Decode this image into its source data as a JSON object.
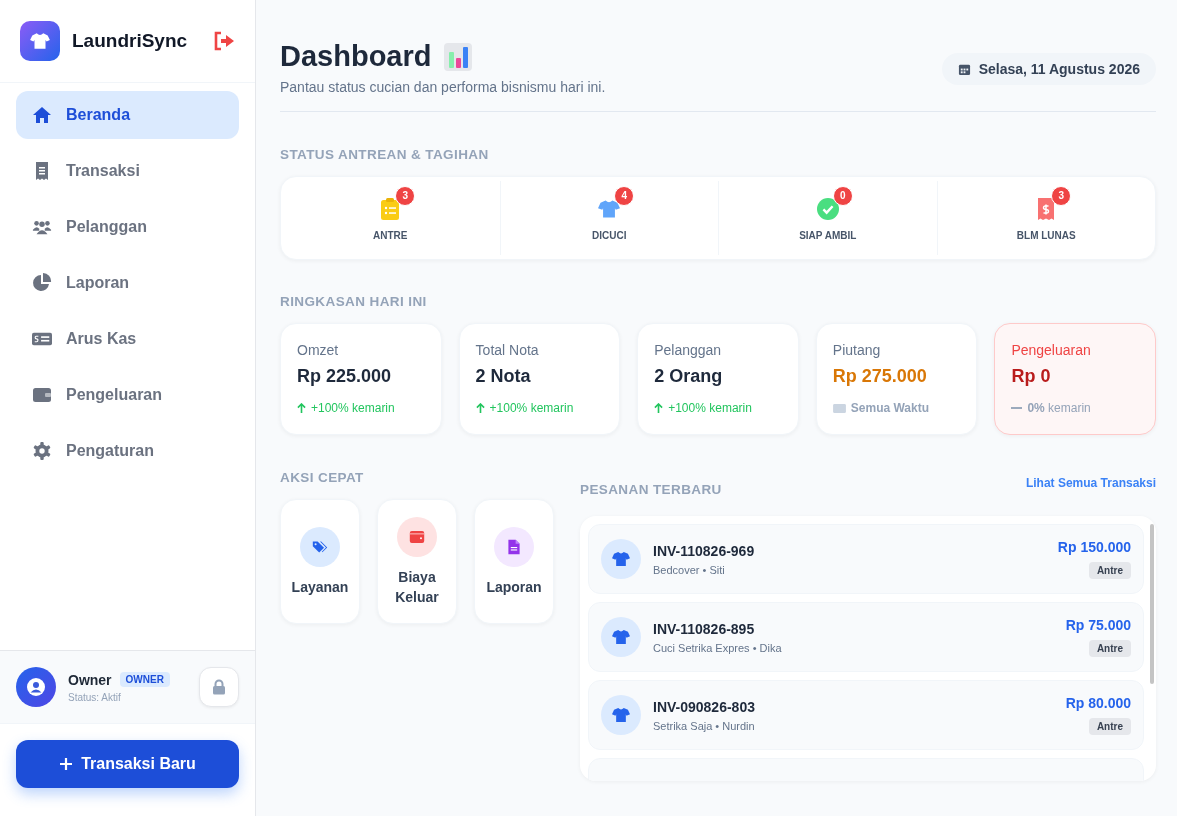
{
  "sidebar": {
    "brand": "LaundriSync",
    "items": [
      {
        "label": "Beranda",
        "kind": "home",
        "selected": true
      },
      {
        "label": "Transaksi",
        "kind": "receipt",
        "selected": false
      },
      {
        "label": "Pelanggan",
        "kind": "users",
        "selected": false
      },
      {
        "label": "Laporan",
        "kind": "pie",
        "selected": false
      },
      {
        "label": "Arus Kas",
        "kind": "cash",
        "selected": false
      },
      {
        "label": "Pengeluaran",
        "kind": "wallet",
        "selected": false
      },
      {
        "label": "Pengaturan",
        "kind": "gear",
        "selected": false
      }
    ],
    "user": {
      "name": "Owner",
      "role": "OWNER",
      "status": "Status: Aktif"
    },
    "new_button": "Transaksi Baru"
  },
  "header": {
    "title": "Dashboard",
    "subtitle": "Pantau status cucian dan performa bisnismu hari ini.",
    "date": "Selasa, 11 Agustus 2026"
  },
  "status": {
    "heading": "STATUS ANTREAN & TAGIHAN",
    "items": [
      {
        "label": "ANTRE",
        "count": "3",
        "kind": "clipboard"
      },
      {
        "label": "DICUCI",
        "count": "4",
        "kind": "shirt"
      },
      {
        "label": "SIAP AMBIL",
        "count": "0",
        "kind": "check"
      },
      {
        "label": "BLM LUNAS",
        "count": "3",
        "kind": "bill"
      }
    ]
  },
  "summary": {
    "heading": "RINGKASAN HARI INI",
    "cards": [
      {
        "label": "Omzet",
        "value": "Rp 225.000",
        "color": "#1e293b",
        "kind": "up",
        "change": "+100%",
        "note": "kemarin",
        "highlighted": false
      },
      {
        "label": "Total Nota",
        "value": "2 Nota",
        "color": "#1e293b",
        "kind": "up",
        "change": "+100%",
        "note": "kemarin",
        "highlighted": false
      },
      {
        "label": "Pelanggan",
        "value": "2 Orang",
        "color": "#1e293b",
        "kind": "up",
        "change": "+100%",
        "note": "kemarin",
        "highlighted": false
      },
      {
        "label": "Piutang",
        "value": "Rp 275.000",
        "color": "#d97706",
        "kind": "period",
        "note": "Semua Waktu",
        "highlighted": false
      },
      {
        "label": "Pengeluaran",
        "value": "Rp 0",
        "color": "#b91c1c",
        "kind": "flat",
        "change": "0%",
        "note": "kemarin",
        "highlighted": true
      }
    ]
  },
  "quick_actions": {
    "heading": "AKSI CEPAT",
    "items": [
      {
        "label": "Layanan",
        "kind": "tag"
      },
      {
        "label": "Biaya Keluar",
        "kind": "wallet"
      },
      {
        "label": "Laporan",
        "kind": "doc"
      }
    ]
  },
  "orders": {
    "heading": "PESANAN TERBARU",
    "link": "Lihat Semua Transaksi",
    "rows": [
      {
        "invoice": "INV-110826-969",
        "detail": "Bedcover • Siti",
        "amount": "Rp 150.000",
        "status": "Antre"
      },
      {
        "invoice": "INV-110826-895",
        "detail": "Cuci Setrika Expres • Dika",
        "amount": "Rp 75.000",
        "status": "Antre"
      },
      {
        "invoice": "INV-090826-803",
        "detail": "Setrika Saja • Nurdin",
        "amount": "Rp 80.000",
        "status": "Antre"
      }
    ]
  }
}
